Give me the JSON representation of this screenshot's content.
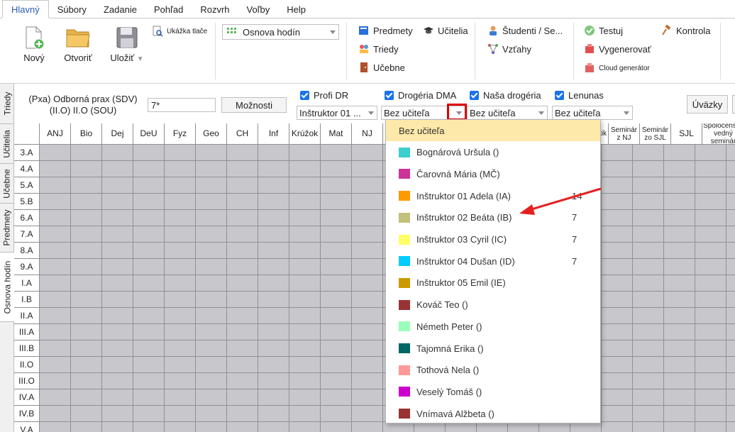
{
  "menu": [
    "Hlavný",
    "Súbory",
    "Zadanie",
    "Pohľad",
    "Rozvrh",
    "Voľby",
    "Help"
  ],
  "ribbon": {
    "new_label": "Nový",
    "open_label": "Otvoriť",
    "save_label": "Uložiť",
    "print_preview_label": "Ukážka tlače",
    "view_combo_value": "Osnova hodín",
    "subjects_label": "Predmety",
    "teachers_label": "Učitelia",
    "classes_label": "Triedy",
    "rooms_label": "Učebne",
    "students_label": "Študenti / Se...",
    "relations_label": "Vzťahy",
    "test_label": "Testuj",
    "generate_label": "Vygenerovať",
    "cloud_label": "Cloud generátor",
    "check_label": "Kontrola"
  },
  "vtabs": [
    "Triedy",
    "Učitelia",
    "Učebne",
    "Predmety",
    "Osnova hodín"
  ],
  "settings": {
    "subject_line1": "(Pxa) Odborná prax (SDV)",
    "subject_line2": "(II.O) II.O (SOU)",
    "value_input": "7*",
    "options_button": "Možnosti",
    "groups": [
      {
        "label": "Profi DR",
        "combo": "Inštruktor 01 ..."
      },
      {
        "label": "Drogéria DMA",
        "combo": "Bez učiteľa"
      },
      {
        "label": "Naša drogéria",
        "combo": "Bez učiteľa"
      },
      {
        "label": "Lenunas",
        "combo": "Bez učiteľa"
      }
    ],
    "workload_button": "Úväzky"
  },
  "grid": {
    "columns": [
      "ANJ",
      "Bio",
      "Dej",
      "DeU",
      "Fyz",
      "Geo",
      "CH",
      "Inf",
      "Krúžok",
      "Mat",
      "NJ"
    ],
    "right_columns": [
      "Seminár z NJ",
      "Seminár zo SJL",
      "SJL",
      "Spoločenský vedný seminár"
    ],
    "right_partial": "ár atik",
    "rows": [
      "3.A",
      "4.A",
      "5.A",
      "5.B",
      "6.A",
      "7.A",
      "8.A",
      "9.A",
      "I.A",
      "I.B",
      "II.A",
      "III.A",
      "III.B",
      "II.O",
      "III.O",
      "IV.A",
      "IV.B",
      "V.A"
    ]
  },
  "dropdown": {
    "items": [
      {
        "name": "Bez učiteľa",
        "color": "",
        "count": ""
      },
      {
        "name": "Bognárová Uršula ()",
        "color": "#3ccfcf",
        "count": ""
      },
      {
        "name": "Čarovná Mária (MČ)",
        "color": "#cc3399",
        "count": ""
      },
      {
        "name": "Inštruktor 01 Adela (IA)",
        "color": "#ff9900",
        "count": "14"
      },
      {
        "name": "Inštruktor 02 Beáta (IB)",
        "color": "#c2c07a",
        "count": "7"
      },
      {
        "name": "Inštruktor 03 Cyril (IC)",
        "color": "#ffff66",
        "count": "7"
      },
      {
        "name": "Inštruktor 04 Dušan (ID)",
        "color": "#00ccff",
        "count": "7"
      },
      {
        "name": "Inštruktor 05 Emil (IE)",
        "color": "#cc9900",
        "count": ""
      },
      {
        "name": "Kováč Teo ()",
        "color": "#993333",
        "count": ""
      },
      {
        "name": "Németh Peter ()",
        "color": "#99ffbb",
        "count": ""
      },
      {
        "name": "Tajomná Erika ()",
        "color": "#006666",
        "count": ""
      },
      {
        "name": "Tothová Nela ()",
        "color": "#ff9999",
        "count": ""
      },
      {
        "name": "Veselý Tomáš ()",
        "color": "#cc00cc",
        "count": ""
      },
      {
        "name": "Vnímavá Alžbeta ()",
        "color": "#993333",
        "count": ""
      }
    ]
  }
}
